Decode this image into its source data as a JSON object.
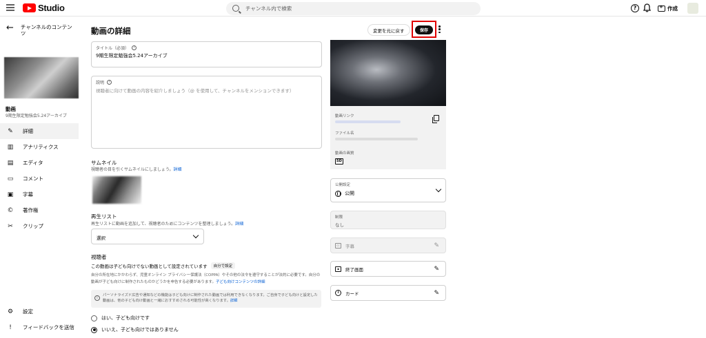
{
  "topbar": {
    "logo_text": "Studio",
    "search_placeholder": "チャンネル内で検索",
    "create_label": "作成"
  },
  "sidebar": {
    "back_label": "チャンネルのコンテンツ",
    "video_tag": "動画",
    "video_title": "9期生限定勉強会5.24アーカイブ",
    "items": [
      {
        "label": "詳細",
        "icon": "pencil-icon",
        "active": true
      },
      {
        "label": "アナリティクス",
        "icon": "analytics-icon"
      },
      {
        "label": "エディタ",
        "icon": "editor-icon"
      },
      {
        "label": "コメント",
        "icon": "comment-icon"
      },
      {
        "label": "字幕",
        "icon": "subtitles-icon"
      },
      {
        "label": "著作権",
        "icon": "copyright-icon"
      },
      {
        "label": "クリップ",
        "icon": "scissors-icon"
      }
    ],
    "bottom_items": [
      {
        "label": "設定",
        "icon": "gear-icon"
      },
      {
        "label": "フィードバックを送信",
        "icon": "feedback-icon"
      }
    ]
  },
  "header": {
    "title": "動画の詳細",
    "revert_label": "変更を元に戻す",
    "save_label": "保存"
  },
  "form": {
    "title_label": "タイトル（必須）",
    "title_value": "9期生限定勉強会5.24アーカイブ",
    "desc_label": "説明",
    "desc_placeholder": "視聴者に向けて動画の内容を紹介しましょう（@ を使用して、チャンネルをメンションできます）",
    "thumb_heading": "サムネイル",
    "thumb_sub": "視聴者の目を引くサムネイルにしましょう。",
    "thumb_link": "詳細",
    "playlist_heading": "再生リスト",
    "playlist_sub": "再生リストに動画を追加して、視聴者のためにコンテンツを整理しましょう。",
    "playlist_link": "詳細",
    "playlist_select": "選択",
    "audience_heading": "視聴者",
    "audience_status": "この動画は子ども向けでない動画として設定されています",
    "audience_pill": "自分で設定",
    "legal_text": "自分の所在地にかかわらず、児童オンライン プライバシー保護法（COPPA）やその他の法令を遵守することが法的に必要です。自分の動画が子ども向けに制作されたものかどうかを申告する必要があります。",
    "legal_link": "子ども向けコンテンツの詳細",
    "notice_text": "パーソナライズド広告や通知などの機能は子ども向けに制作された動画では利用できなくなります。ご自身で子ども向けと設定した動画は、他の子ども向け動画と一緒におすすめされる可能性が高くなります。",
    "notice_link": "詳細",
    "radio_yes": "はい、子ども向けです",
    "radio_no": "いいえ、子ども向けではありません"
  },
  "right": {
    "video_link_label": "動画リンク",
    "file_name_label": "ファイル名",
    "quality_label": "動画の画質",
    "quality_badge": "SD",
    "visibility_label": "公開設定",
    "visibility_value": "公開",
    "restriction_label": "制限",
    "restriction_value": "なし",
    "subtitles_label": "字幕",
    "end_screen_label": "終了画面",
    "cards_label": "カード"
  },
  "colors": {
    "accent_red": "#ff0000",
    "highlight_box": "#e00000",
    "link_blue": "#065fd4"
  }
}
